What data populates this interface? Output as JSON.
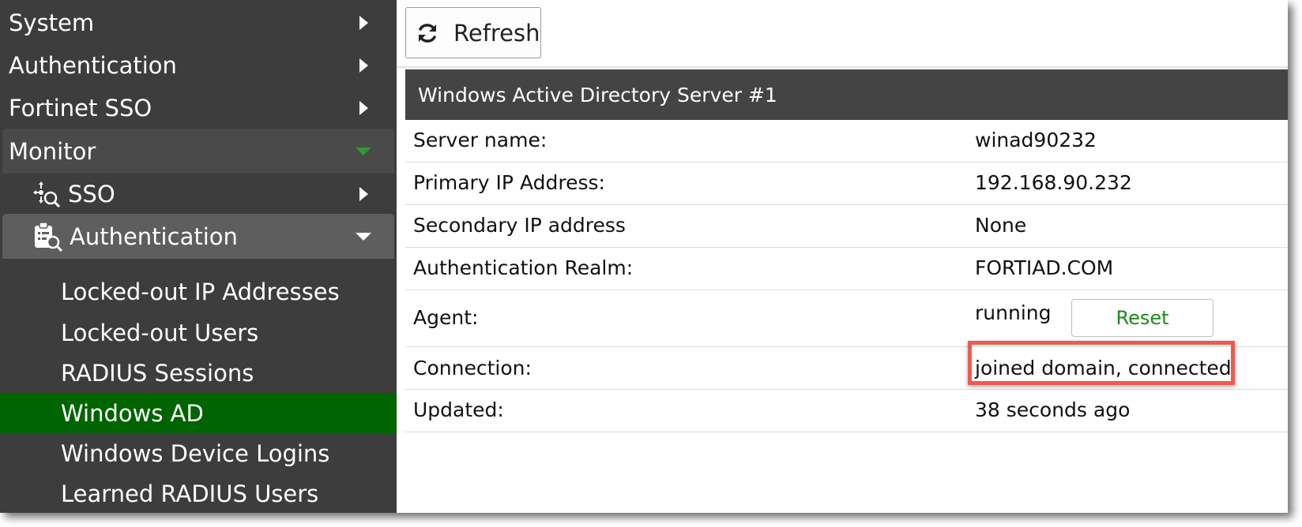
{
  "sidebar": {
    "top_items": [
      {
        "label": "System",
        "expanded": false
      },
      {
        "label": "Authentication",
        "expanded": false
      },
      {
        "label": "Fortinet SSO",
        "expanded": false
      },
      {
        "label": "Monitor",
        "expanded": true
      }
    ],
    "groups": [
      {
        "label": "SSO",
        "icon": "sso-monitor-icon",
        "expanded": false
      },
      {
        "label": "Authentication",
        "icon": "clipboard-search-icon",
        "expanded": true
      }
    ],
    "sub_items": [
      {
        "label": "Locked-out IP Addresses",
        "active": false
      },
      {
        "label": "Locked-out Users",
        "active": false
      },
      {
        "label": "RADIUS Sessions",
        "active": false
      },
      {
        "label": "Windows AD",
        "active": true
      },
      {
        "label": "Windows Device Logins",
        "active": false
      },
      {
        "label": "Learned RADIUS Users",
        "active": false
      }
    ],
    "colors": {
      "background": "#3d3d3d",
      "active": "#006400",
      "monitor_group": "#4a4a4a",
      "auth_group": "#5e5e5e",
      "chevron_green": "#2e9a2e"
    }
  },
  "toolbar": {
    "refresh_label": "Refresh",
    "refresh_icon": "refresh-icon"
  },
  "panel": {
    "title": "Windows Active Directory Server #1",
    "rows": [
      {
        "label": "Server name:",
        "value": "winad90232"
      },
      {
        "label": "Primary IP Address:",
        "value": "192.168.90.232"
      },
      {
        "label": "Secondary IP address",
        "value": "None"
      },
      {
        "label": "Authentication Realm:",
        "value": "FORTIAD.COM"
      },
      {
        "label": "Agent:",
        "value": "running",
        "button": "Reset"
      },
      {
        "label": "Connection:",
        "value": "joined domain, connected",
        "highlighted": true
      },
      {
        "label": "Updated:",
        "value": "38 seconds ago"
      }
    ],
    "colors": {
      "header": "#444444",
      "reset_text": "#1b8a1b",
      "highlight": "#ef5a4f"
    }
  }
}
